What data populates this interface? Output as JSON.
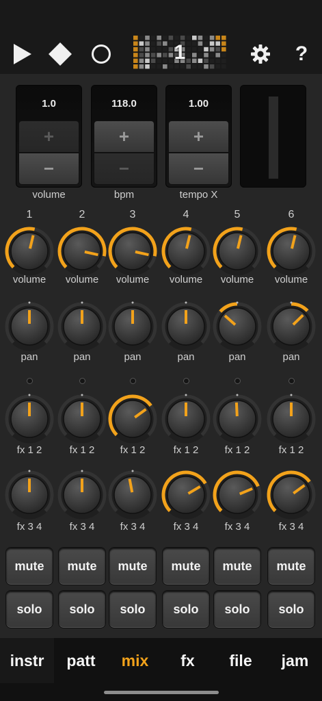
{
  "transport": {
    "play_icon": "play-icon",
    "stop_icon": "stop-diamond-icon",
    "record_icon": "record-circle-icon",
    "pattern_number": "1",
    "settings_icon": "gear-icon",
    "help_label": "?"
  },
  "panels": [
    {
      "value": "1.0",
      "label": "volume"
    },
    {
      "value": "118.0",
      "label": "bpm"
    },
    {
      "value": "1.00",
      "label": "tempo X"
    }
  ],
  "button_glyphs": {
    "plus": "+",
    "minus": "−"
  },
  "channels": [
    {
      "num": "1",
      "volume": 0.55,
      "pan": 0.5,
      "fx12": 0.5,
      "fx34": 0.5
    },
    {
      "num": "2",
      "volume": 0.88,
      "pan": 0.5,
      "fx12": 0.5,
      "fx34": 0.5
    },
    {
      "num": "3",
      "volume": 0.88,
      "pan": 0.5,
      "fx12": 0.7,
      "fx34": 0.46
    },
    {
      "num": "4",
      "volume": 0.55,
      "pan": 0.5,
      "fx12": 0.5,
      "fx34": 0.72
    },
    {
      "num": "5",
      "volume": 0.55,
      "pan": 0.32,
      "fx12": 0.49,
      "fx34": 0.75
    },
    {
      "num": "6",
      "volume": 0.55,
      "pan": 0.67,
      "fx12": 0.5,
      "fx34": 0.7
    }
  ],
  "knob_labels": {
    "volume": "volume",
    "pan": "pan",
    "fx12": "fx 1 2",
    "fx34": "fx 3 4"
  },
  "buttons": {
    "mute": "mute",
    "solo": "solo"
  },
  "tabs": [
    {
      "id": "instr",
      "label": "instr",
      "active": false
    },
    {
      "id": "patt",
      "label": "patt",
      "active": false
    },
    {
      "id": "mix",
      "label": "mix",
      "active": true
    },
    {
      "id": "fx",
      "label": "fx",
      "active": false
    },
    {
      "id": "file",
      "label": "file",
      "active": false
    },
    {
      "id": "jam",
      "label": "jam",
      "active": false
    }
  ],
  "colors": {
    "accent": "#f2a21b",
    "background": "#262626",
    "topbar": "#191919"
  }
}
